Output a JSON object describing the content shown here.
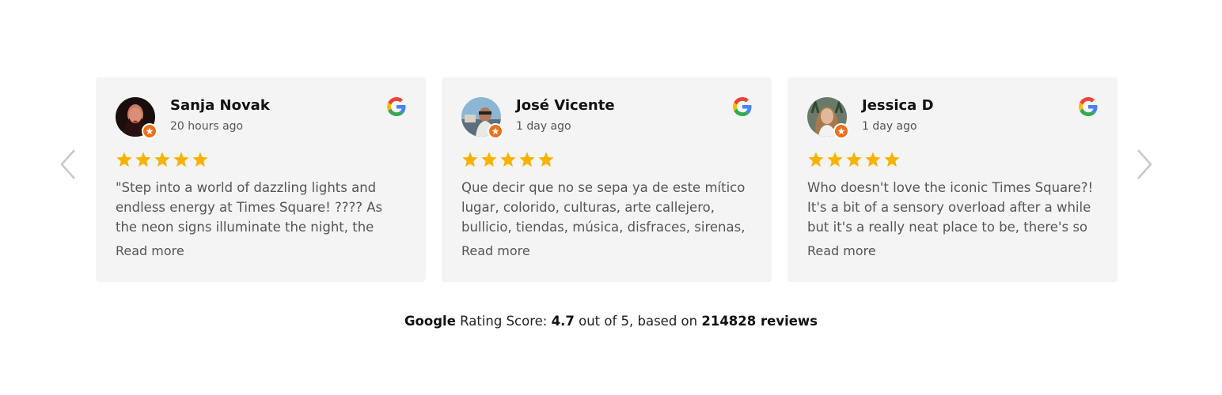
{
  "carousel": {
    "prev_icon": "chevron-left-icon",
    "next_icon": "chevron-right-icon",
    "reviews": [
      {
        "name": "Sanja Novak",
        "time": "20 hours ago",
        "rating": 5,
        "text": "\"Step into a world of dazzling lights and endless energy at Times Square! ???? As the neon signs illuminate the night, the bustling",
        "read_more": "Read more"
      },
      {
        "name": "José Vicente",
        "time": "1 day ago",
        "rating": 5,
        "text": "Que decir que no se sepa ya de este mítico lugar, colorido, culturas, arte callejero, bullicio, tiendas, música, disfraces, sirenas,",
        "read_more": "Read more"
      },
      {
        "name": "Jessica D",
        "time": "1 day ago",
        "rating": 5,
        "text": "Who doesn't love the iconic Times Square?! It's a bit of a sensory overload after a while but it's a really neat place to be, there's so",
        "read_more": "Read more"
      }
    ]
  },
  "summary": {
    "brand": "Google",
    "label": "Rating Score:",
    "score": "4.7",
    "out_of": "out of 5, based on",
    "count": "214828 reviews"
  },
  "colors": {
    "card_bg": "#f4f4f4",
    "star": "#f5b300",
    "badge": "#e8711c"
  }
}
